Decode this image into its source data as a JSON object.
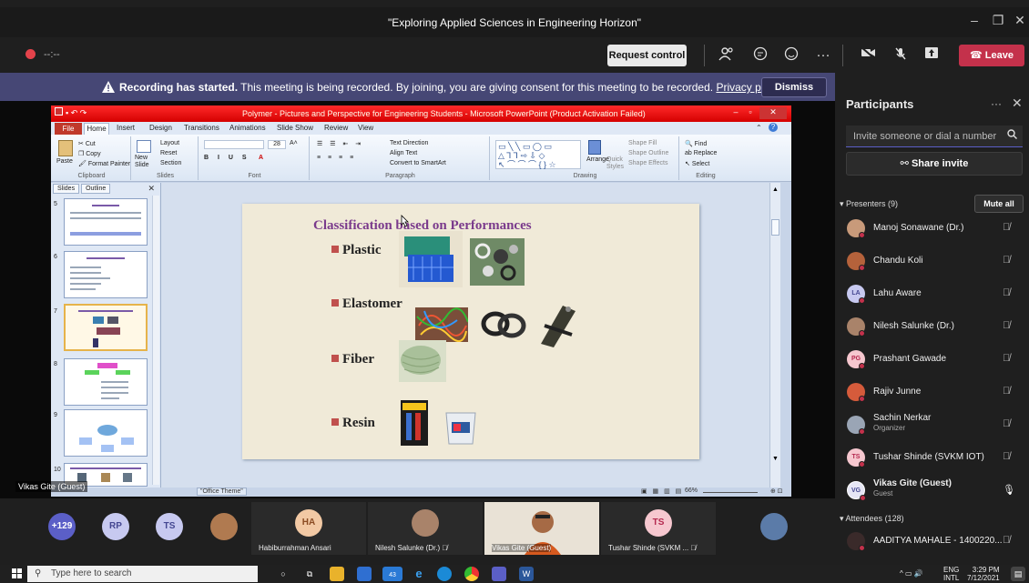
{
  "window": {
    "title": "\"Exploring Applied Sciences in Engineering Horizon\"",
    "minimize": "–",
    "maximize": "❐",
    "close": "✕"
  },
  "toolbar": {
    "rec_time": "--:--",
    "request_control": "Request control",
    "leave": "Leave",
    "icons": [
      "people-icon",
      "chat-icon",
      "reactions-icon",
      "more-icon",
      "camera-off-icon",
      "mic-off-icon",
      "share-icon"
    ]
  },
  "banner": {
    "bold": "Recording has started.",
    "text": " This meeting is being recorded. By joining, you are giving consent for this meeting to be recorded. ",
    "link": "Privacy policy",
    "dismiss": "Dismiss"
  },
  "ppt": {
    "window_title": "Polymer - Pictures and Perspective for Engineering Students - Microsoft PowerPoint (Product Activation Failed)",
    "tabs": [
      "File",
      "Home",
      "Insert",
      "Design",
      "Transitions",
      "Animations",
      "Slide Show",
      "Review",
      "View"
    ],
    "ribbon": {
      "clipboard": {
        "label": "Clipboard",
        "paste": "Paste",
        "cut": "Cut",
        "copy": "Copy",
        "format_painter": "Format Painter"
      },
      "slides": {
        "label": "Slides",
        "new_slide": "New Slide",
        "layout": "Layout",
        "reset": "Reset",
        "section": "Section"
      },
      "font": {
        "label": "Font",
        "size": "28"
      },
      "paragraph": {
        "label": "Paragraph",
        "text_direction": "Text Direction",
        "align_text": "Align Text",
        "convert": "Convert to SmartArt"
      },
      "drawing": {
        "label": "Drawing",
        "arrange": "Arrange",
        "quick_styles": "Quick Styles",
        "shape_fill": "Shape Fill",
        "shape_outline": "Shape Outline",
        "shape_effects": "Shape Effects"
      },
      "editing": {
        "label": "Editing",
        "find": "Find",
        "replace": "Replace",
        "select": "Select"
      }
    },
    "panel_tabs": [
      "Slides",
      "Outline"
    ],
    "thumbs": [
      "5",
      "6",
      "7",
      "8",
      "9",
      "10"
    ],
    "slide": {
      "title": "Classification based on Performances",
      "bullets": [
        "Plastic",
        "Elastomer",
        "Fiber",
        "Resin"
      ]
    },
    "status": {
      "theme": "\"Office Theme\"",
      "zoom": "66%"
    }
  },
  "stage_label": "Vikas Gite (Guest)",
  "participants": {
    "title": "Participants",
    "invite_placeholder": "Invite someone or dial a number",
    "share_invite": "Share invite",
    "presenters_label": "Presenters (9)",
    "mute_all": "Mute all",
    "attendees_label": "Attendees (128)",
    "presenters": [
      {
        "name": "Manoj Sonawane (Dr.)",
        "initials": "",
        "sub": "",
        "color": "#c89a7a"
      },
      {
        "name": "Chandu Koli",
        "initials": "",
        "sub": "",
        "color": "#b5623b"
      },
      {
        "name": "Lahu Aware",
        "initials": "LA",
        "sub": "",
        "color": "#c7c9f0"
      },
      {
        "name": "Nilesh Salunke (Dr.)",
        "initials": "",
        "sub": "",
        "color": "#a9836a"
      },
      {
        "name": "Prashant Gawade",
        "initials": "PG",
        "sub": "",
        "color": "#f6c7cf"
      },
      {
        "name": "Rajiv Junne",
        "initials": "",
        "sub": "",
        "color": "#d55b3b"
      },
      {
        "name": "Sachin Nerkar",
        "initials": "",
        "sub": "Organizer",
        "color": "#9aa5b5"
      },
      {
        "name": "Tushar Shinde (SVKM IOT)",
        "initials": "TS",
        "sub": "",
        "color": "#f6c7cf"
      },
      {
        "name": "Vikas Gite (Guest)",
        "initials": "VG",
        "sub": "Guest",
        "color": "#e6e6f5"
      }
    ],
    "attendee_first": "AADITYA MAHALE - 1400220..."
  },
  "gallery": {
    "overflow": "+129",
    "circles": [
      "RP",
      "TS"
    ],
    "tiles": [
      {
        "initials": "HA",
        "name": "Habiburrahman Ansari"
      },
      {
        "initials": "",
        "name": "Nilesh Salunke (Dr.)"
      },
      {
        "initials": "",
        "name": "Vikas Gite (Guest)"
      },
      {
        "initials": "TS",
        "name": "Tushar Shinde (SVKM ..."
      }
    ]
  },
  "taskbar": {
    "search": "Type here to search",
    "lang": "ENG",
    "region": "INTL",
    "time": "3:29 PM",
    "date": "7/12/2021",
    "mail_badge": "43"
  }
}
